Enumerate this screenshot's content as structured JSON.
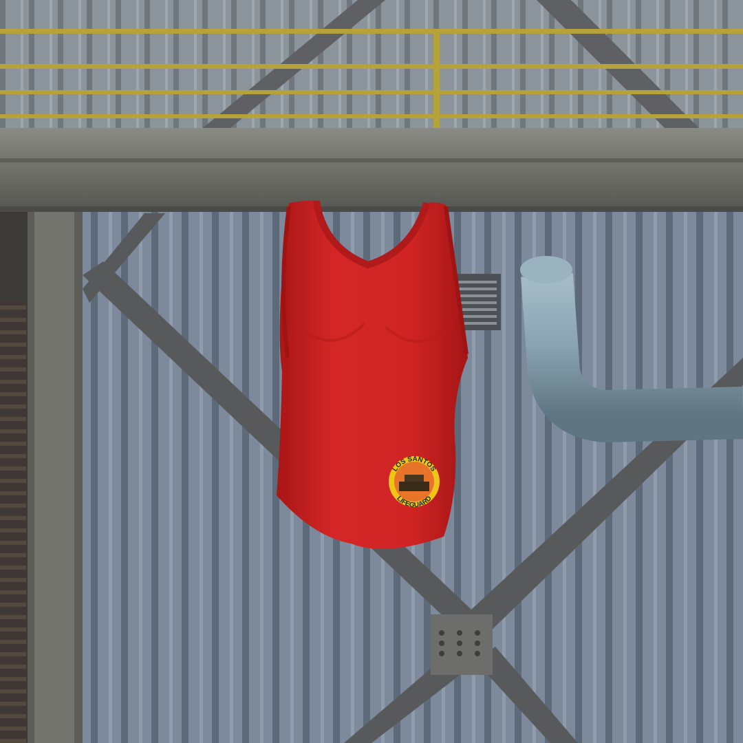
{
  "scene": {
    "type": "game clothing preview render",
    "garment": {
      "kind": "tank top",
      "color": "#cf2222",
      "badge": {
        "top_text": "LOS SANTOS",
        "bottom_text": "LIFEGUARD",
        "ring_color": "#f0c419",
        "fill_color": "#e8742a"
      }
    },
    "backdrop": {
      "wall_color": "#738296",
      "beam_color": "#6b6c66",
      "railing_color": "#b5a23a",
      "pipe_color": "#8fa9b6"
    }
  }
}
